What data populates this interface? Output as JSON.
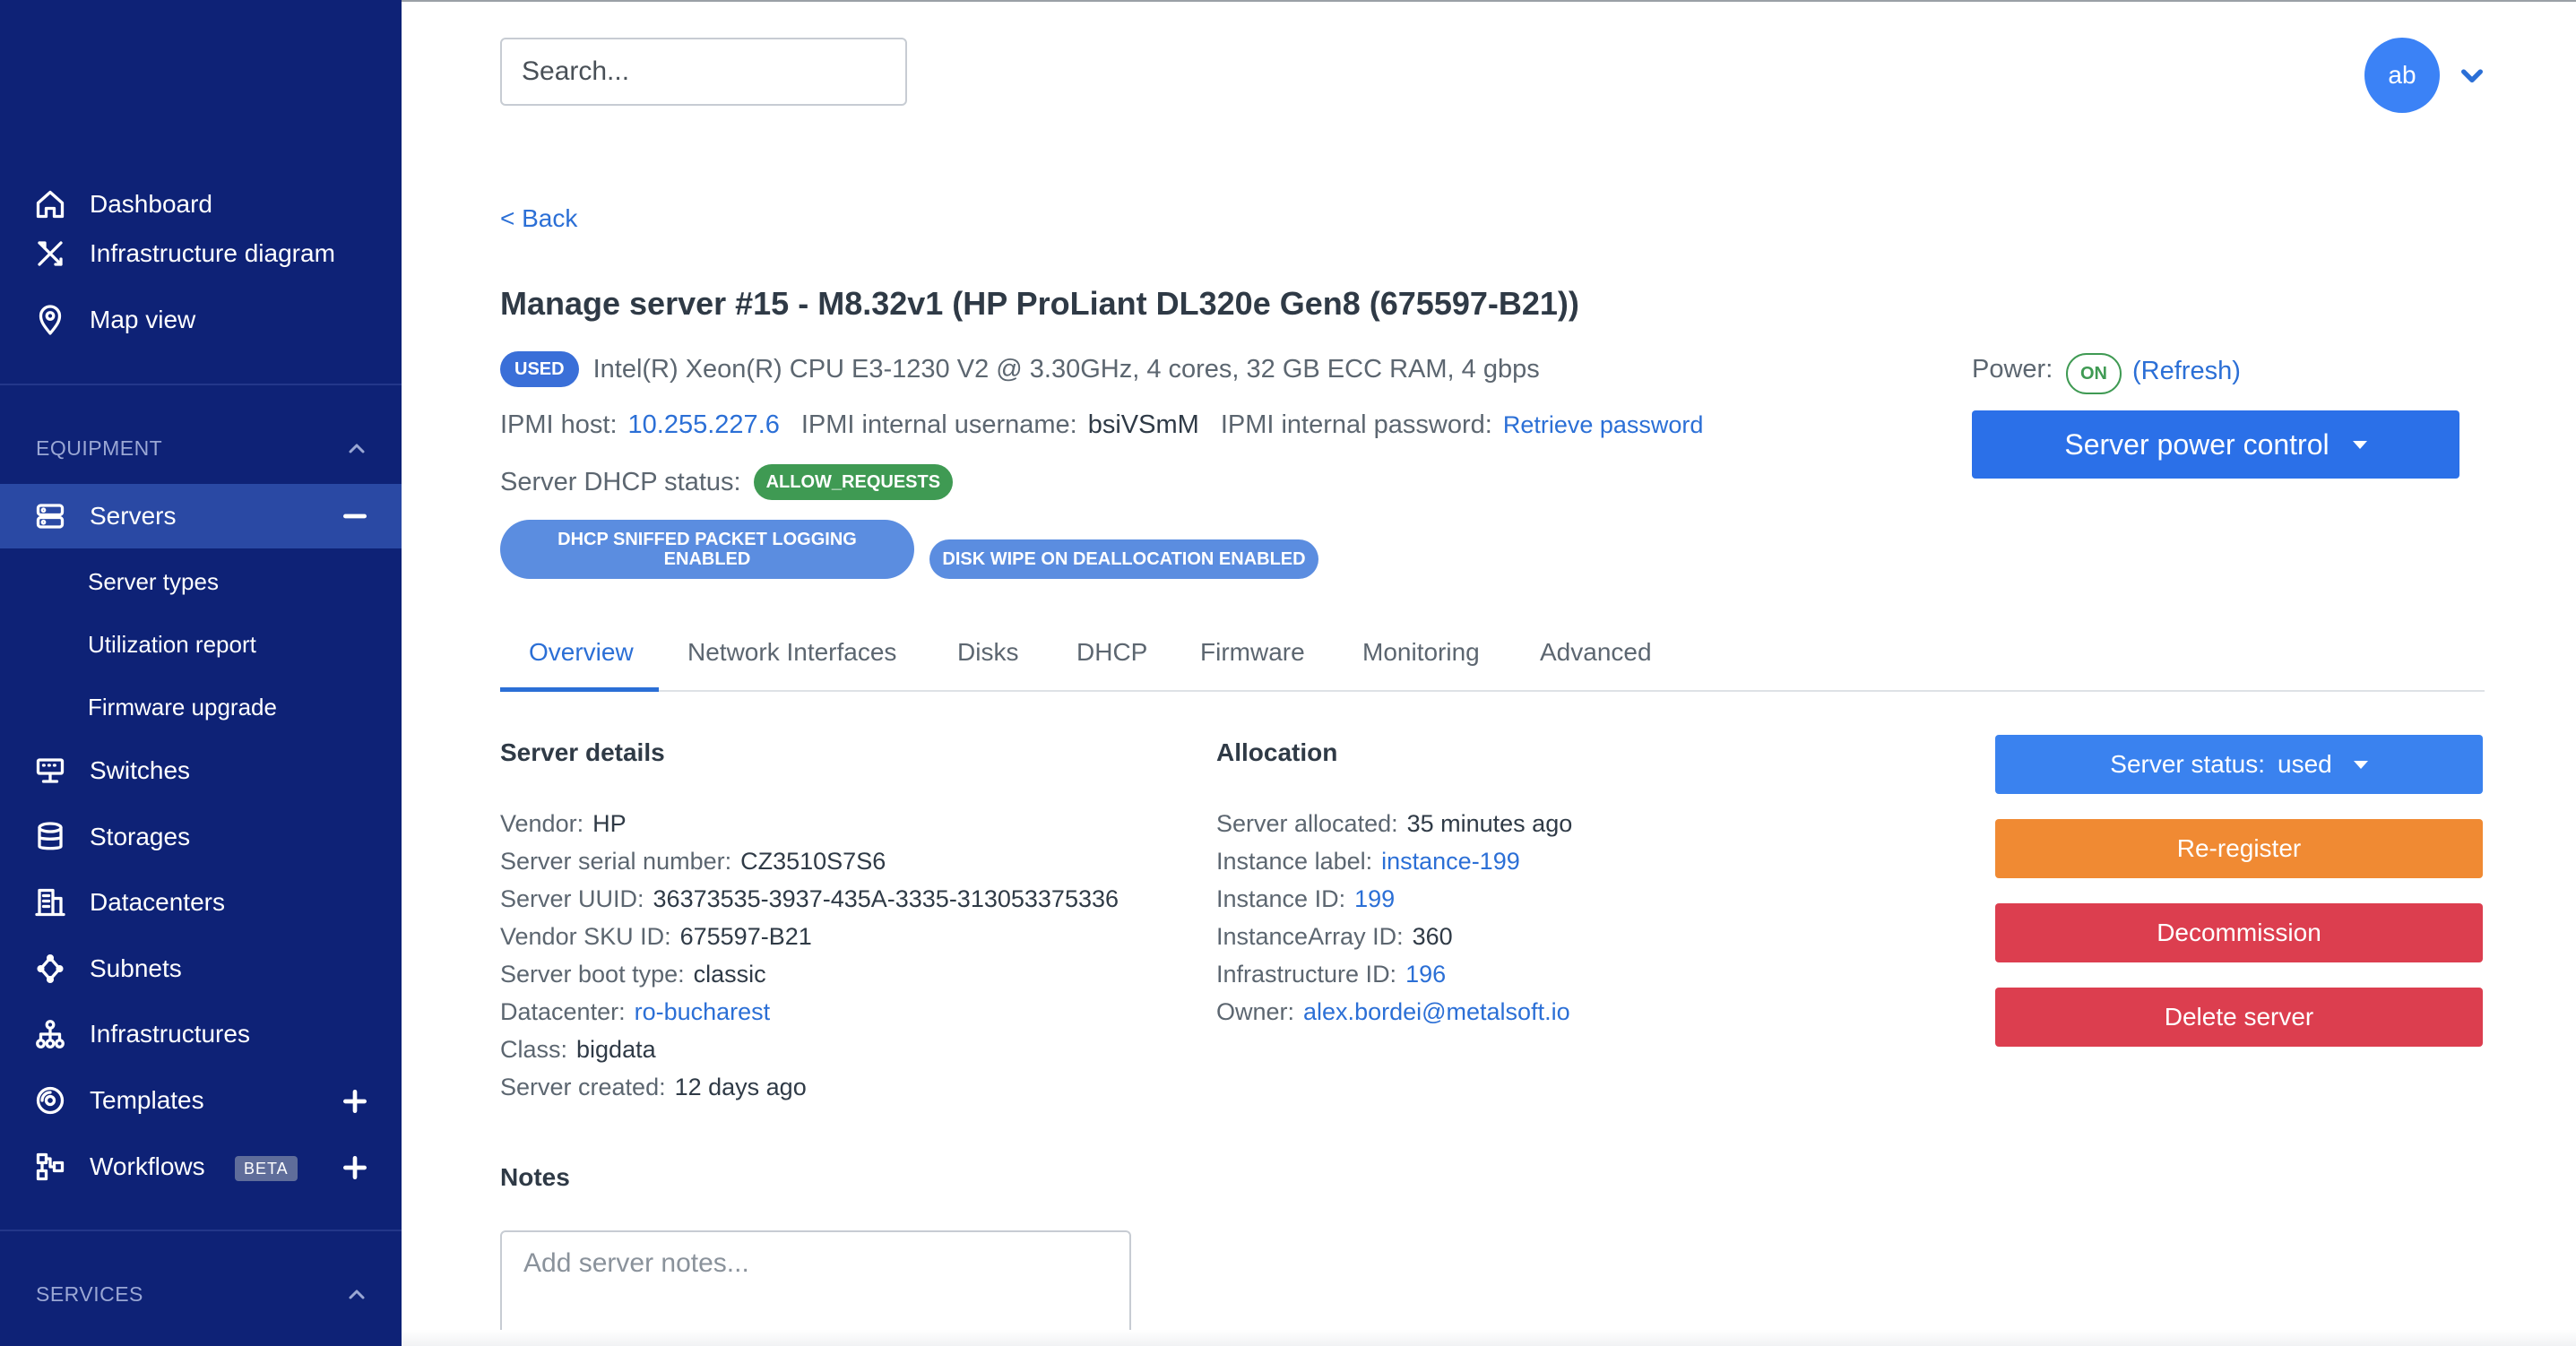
{
  "sidebar": {
    "items_top": [
      {
        "label": "Dashboard",
        "icon": "home-icon"
      },
      {
        "label": "Infrastructure diagram",
        "icon": "tools-icon"
      },
      {
        "label": "Map view",
        "icon": "map-pin-icon"
      }
    ],
    "equipment_header": "EQUIPMENT",
    "servers_label": "Servers",
    "server_subitems": [
      "Server types",
      "Utilization report",
      "Firmware upgrade"
    ],
    "items_equipment": [
      {
        "label": "Switches",
        "icon": "switch-icon"
      },
      {
        "label": "Storages",
        "icon": "database-icon"
      },
      {
        "label": "Datacenters",
        "icon": "building-icon"
      },
      {
        "label": "Subnets",
        "icon": "subnet-icon"
      },
      {
        "label": "Infrastructures",
        "icon": "hierarchy-icon"
      },
      {
        "label": "Templates",
        "icon": "disc-icon"
      },
      {
        "label": "Workflows",
        "icon": "workflow-icon"
      }
    ],
    "workflows_badge": "BETA",
    "services_header": "SERVICES"
  },
  "topbar": {
    "search_placeholder": "Search...",
    "avatar_initials": "ab"
  },
  "page": {
    "back_label": "< Back",
    "title": "Manage server #15 - M8.32v1 (HP ProLiant DL320e Gen8 (675597-B21))",
    "used_badge": "USED",
    "specs": "Intel(R) Xeon(R) CPU E3-1230 V2 @ 3.30GHz, 4 cores, 32 GB ECC RAM, 4 gbps",
    "ipmi_host_label": "IPMI host:",
    "ipmi_host_value": "10.255.227.6",
    "ipmi_user_label": "IPMI internal username:",
    "ipmi_user_value": "bsiVSmM",
    "ipmi_pass_label": "IPMI internal password:",
    "ipmi_pass_link": "Retrieve password",
    "dhcp_status_label": "Server DHCP status:",
    "dhcp_status_value": "ALLOW_REQUESTS",
    "pill_dhcp_line1": "DHCP SNIFFED PACKET LOGGING",
    "pill_dhcp_line2": "ENABLED",
    "pill_disk_wipe": "DISK WIPE ON DEALLOCATION ENABLED",
    "power_label": "Power:",
    "power_state": "ON",
    "refresh_label": "(Refresh)",
    "power_control_label": "Server power control"
  },
  "tabs": [
    "Overview",
    "Network Interfaces",
    "Disks",
    "DHCP",
    "Firmware",
    "Monitoring",
    "Advanced"
  ],
  "server_details": {
    "title": "Server details",
    "rows": [
      {
        "label": "Vendor:",
        "value": "HP"
      },
      {
        "label": "Server serial number:",
        "value": "CZ3510S7S6"
      },
      {
        "label": "Server UUID:",
        "value": "36373535-3937-435A-3335-313053375336"
      },
      {
        "label": "Vendor SKU ID:",
        "value": "675597-B21"
      },
      {
        "label": "Server boot type:",
        "value": "classic"
      },
      {
        "label": "Datacenter:",
        "value": "ro-bucharest"
      },
      {
        "label": "Class:",
        "value": "bigdata"
      },
      {
        "label": "Server created:",
        "value": "12 days ago"
      }
    ]
  },
  "allocation": {
    "title": "Allocation",
    "rows": [
      {
        "label": "Server allocated:",
        "value": "35 minutes ago"
      },
      {
        "label": "Instance label:",
        "value": "instance-199"
      },
      {
        "label": "Instance ID:",
        "value": "199"
      },
      {
        "label": "InstanceArray ID:",
        "value": "360"
      },
      {
        "label": "Infrastructure ID:",
        "value": "196"
      },
      {
        "label": "Owner:",
        "value": "alex.bordei@metalsoft.io"
      }
    ]
  },
  "actions": {
    "status_label": "Server status:",
    "status_value": "used",
    "reregister": "Re-register",
    "decommission": "Decommission",
    "delete": "Delete server"
  },
  "notes": {
    "title": "Notes",
    "placeholder": "Add server notes..."
  },
  "colors": {
    "sidebar_bg": "#0e2276",
    "sidebar_active": "#2a49a4",
    "primary": "#2b70e8",
    "link": "#2b6fd6",
    "success": "#3f9a53",
    "warning": "#f08a33",
    "danger": "#dc3e4f"
  }
}
